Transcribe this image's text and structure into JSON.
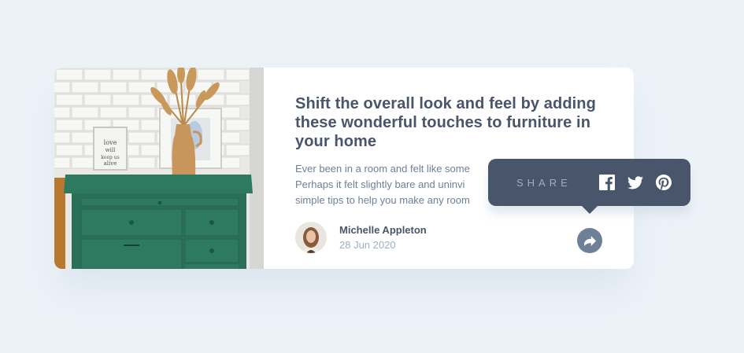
{
  "article": {
    "title": "Shift the overall look and feel by adding these wonderful touches to furniture in your home",
    "excerpt_line1": "Ever been in a room and felt like some",
    "excerpt_line2": "Perhaps it felt slightly bare and uninvi",
    "excerpt_line3": "simple tips to help you make any room"
  },
  "author": {
    "name": "Michelle Appleton",
    "date": "28 Jun 2020"
  },
  "share": {
    "label": "SHARE",
    "networks": [
      "facebook-icon",
      "twitter-icon",
      "pinterest-icon"
    ]
  },
  "colors": {
    "background": "#ecf2f8",
    "dark_blue": "#48556a",
    "grayish_blue": "#6e8098",
    "light_grayish_blue": "#9eafc2",
    "dresser_green": "#2f7a62"
  }
}
